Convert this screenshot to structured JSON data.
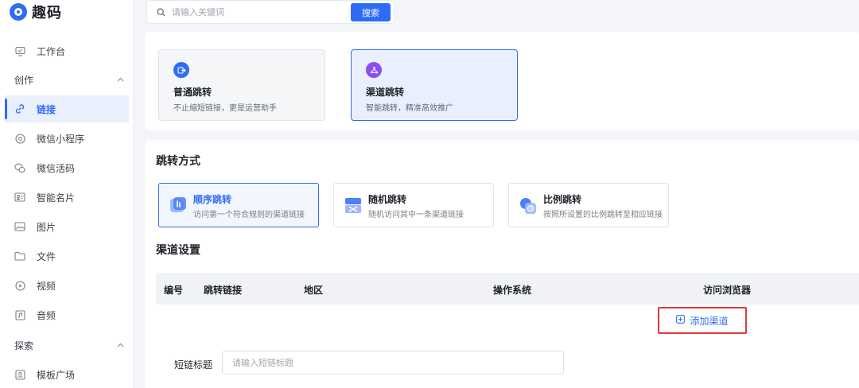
{
  "app": {
    "logo_text": "趣码"
  },
  "search": {
    "placeholder": "请输入关键词",
    "button_label": "搜索"
  },
  "sidebar": {
    "items": [
      {
        "label": "工作台",
        "icon": "workbench-icon"
      },
      {
        "label": "链接",
        "icon": "link-icon"
      },
      {
        "label": "微信小程序",
        "icon": "miniprogram-icon"
      },
      {
        "label": "微信活码",
        "icon": "wechat-livecode-icon"
      },
      {
        "label": "智能名片",
        "icon": "card-icon"
      },
      {
        "label": "图片",
        "icon": "image-icon"
      },
      {
        "label": "文件",
        "icon": "file-icon"
      },
      {
        "label": "视频",
        "icon": "video-icon"
      },
      {
        "label": "音频",
        "icon": "audio-icon"
      },
      {
        "label": "模板广场",
        "icon": "template-icon"
      }
    ],
    "groups": [
      {
        "label": "创作"
      },
      {
        "label": "探索"
      }
    ],
    "active_color": "#2f6cf6"
  },
  "jump_types": [
    {
      "title": "普通跳转",
      "desc": "不止缩短链接，更是运营助手",
      "icon": "redirect-icon",
      "color": "#2f6cf6"
    },
    {
      "title": "渠道跳转",
      "desc": "智能跳转，精准高效推广",
      "icon": "channel-icon",
      "color": "#8a4ff0"
    }
  ],
  "jump_mode": {
    "title": "跳转方式",
    "options": [
      {
        "title": "顺序跳转",
        "desc": "访问第一个符合规则的渠道链接",
        "icon": "sequence-icon"
      },
      {
        "title": "随机跳转",
        "desc": "随机访问其中一条渠道链接",
        "icon": "random-icon"
      },
      {
        "title": "比例跳转",
        "desc": "按照所设置的比例跳转至相应链接",
        "icon": "ratio-icon"
      }
    ]
  },
  "channel_settings": {
    "title": "渠道设置",
    "columns": [
      "编号",
      "跳转链接",
      "地区",
      "操作系统",
      "访问浏览器"
    ],
    "add_button_label": "添加渠道",
    "highlight_color": "#e03a3a"
  },
  "short_title": {
    "label": "短链标题",
    "placeholder": "请输入短链标题"
  }
}
